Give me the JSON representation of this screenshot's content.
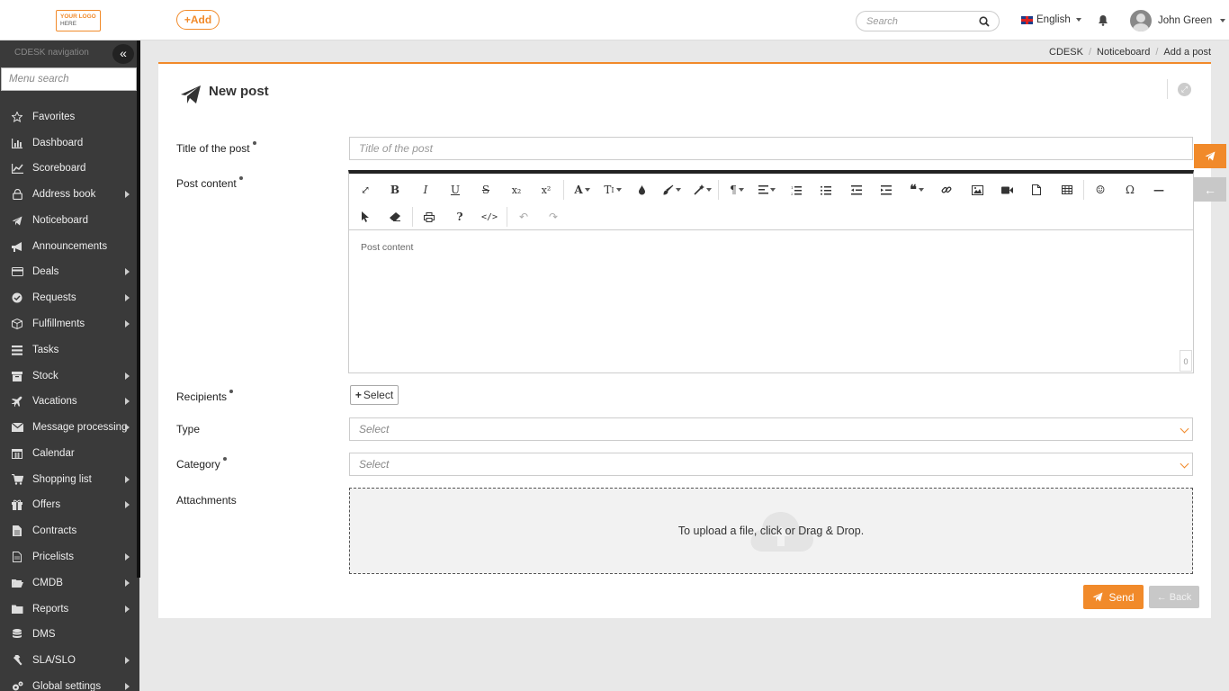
{
  "topbar": {
    "logo_line1": "YOUR LOGO",
    "logo_line2": "HERE",
    "add_label": "+Add",
    "search_placeholder": "Search",
    "language": "English",
    "user_name": "John Green"
  },
  "sidebar": {
    "title": "CDESK navigation",
    "collapse_glyph": "«",
    "search_placeholder": "Menu search",
    "items": [
      {
        "label": "Favorites",
        "icon": "star-icon",
        "arrow": false
      },
      {
        "label": "Dashboard",
        "icon": "bar-chart-icon",
        "arrow": false
      },
      {
        "label": "Scoreboard",
        "icon": "line-chart-icon",
        "arrow": false
      },
      {
        "label": "Address book",
        "icon": "lock-icon",
        "arrow": true
      },
      {
        "label": "Noticeboard",
        "icon": "paper-plane-icon",
        "arrow": false
      },
      {
        "label": "Announcements",
        "icon": "bullhorn-icon",
        "arrow": false
      },
      {
        "label": "Deals",
        "icon": "credit-card-icon",
        "arrow": true
      },
      {
        "label": "Requests",
        "icon": "check-circle-icon",
        "arrow": true
      },
      {
        "label": "Fulfillments",
        "icon": "cube-icon",
        "arrow": true
      },
      {
        "label": "Tasks",
        "icon": "tasks-icon",
        "arrow": false
      },
      {
        "label": "Stock",
        "icon": "box-icon",
        "arrow": true
      },
      {
        "label": "Vacations",
        "icon": "plane-icon",
        "arrow": true
      },
      {
        "label": "Message processing",
        "icon": "envelope-icon",
        "arrow": true
      },
      {
        "label": "Calendar",
        "icon": "calendar-icon",
        "arrow": false
      },
      {
        "label": "Shopping list",
        "icon": "cart-icon",
        "arrow": true
      },
      {
        "label": "Offers",
        "icon": "gift-icon",
        "arrow": true
      },
      {
        "label": "Contracts",
        "icon": "file-icon",
        "arrow": false
      },
      {
        "label": "Pricelists",
        "icon": "document-icon",
        "arrow": true
      },
      {
        "label": "CMDB",
        "icon": "folder-open-icon",
        "arrow": true
      },
      {
        "label": "Reports",
        "icon": "folder-icon",
        "arrow": true
      },
      {
        "label": "DMS",
        "icon": "database-icon",
        "arrow": false
      },
      {
        "label": "SLA/SLO",
        "icon": "gavel-icon",
        "arrow": true
      },
      {
        "label": "Global settings",
        "icon": "cogs-icon",
        "arrow": true
      }
    ]
  },
  "breadcrumb": [
    "CDESK",
    "Noticeboard",
    "Add a post"
  ],
  "panel": {
    "title": "New post"
  },
  "form": {
    "title_label": "Title of the post",
    "title_placeholder": "Title of the post",
    "content_label": "Post content",
    "content_placeholder": "Post content",
    "char_count": "0",
    "recipients_label": "Recipients",
    "select_button": "Select",
    "type_label": "Type",
    "type_value": "Select",
    "category_label": "Category",
    "category_value": "Select",
    "attachments_label": "Attachments",
    "dropzone_text": "To upload a file, click or Drag & Drop.",
    "send_label": "Send",
    "back_label": "Back"
  },
  "colors": {
    "accent": "#f18a2a",
    "sidebar_bg": "#3a3a3a"
  }
}
